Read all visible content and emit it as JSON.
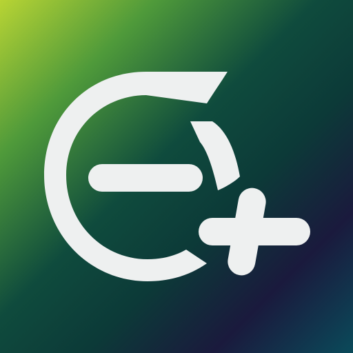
{
  "icon": {
    "name": "e-plus-logo",
    "colors": {
      "gradient_top_left": "#b8d434",
      "gradient_upper": "#4f9a3a",
      "gradient_mid": "#0f4b3d",
      "gradient_lower": "#0c3a38",
      "gradient_navy": "#1a1a3d",
      "gradient_bottom_right": "#0a4a5a",
      "glyph": "#eef0f0"
    }
  }
}
